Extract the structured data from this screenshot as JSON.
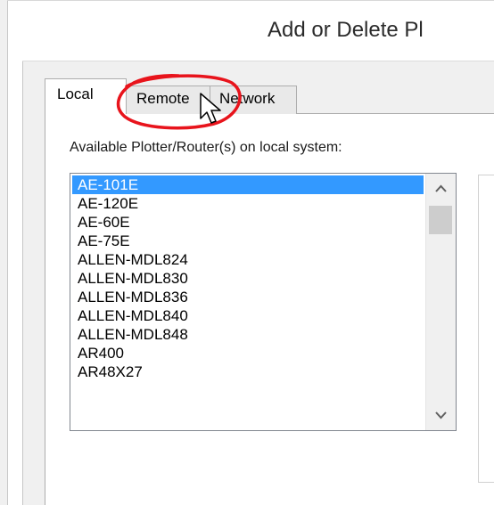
{
  "dialog": {
    "title": "Add or Delete Pl"
  },
  "tabs": [
    {
      "label": "Local",
      "selected": true
    },
    {
      "label": "Remote",
      "selected": false
    },
    {
      "label": "Network",
      "selected": false
    }
  ],
  "plotter_list": {
    "label": "Available Plotter/Router(s) on local system:",
    "items": [
      {
        "label": "AE-101E",
        "selected": true
      },
      {
        "label": "AE-120E",
        "selected": false
      },
      {
        "label": "AE-60E",
        "selected": false
      },
      {
        "label": "AE-75E",
        "selected": false
      },
      {
        "label": "ALLEN-MDL824",
        "selected": false
      },
      {
        "label": "ALLEN-MDL830",
        "selected": false
      },
      {
        "label": "ALLEN-MDL836",
        "selected": false
      },
      {
        "label": "ALLEN-MDL840",
        "selected": false
      },
      {
        "label": "ALLEN-MDL848",
        "selected": false
      },
      {
        "label": "AR400",
        "selected": false
      },
      {
        "label": "AR48X27",
        "selected": false
      }
    ]
  },
  "icons": {
    "scroll_up": "chevron-up-icon",
    "scroll_down": "chevron-down-icon",
    "cursor": "mouse-cursor-icon"
  },
  "colors": {
    "selection": "#3399ff",
    "annotation": "#e8141c",
    "panel_background": "#f0f0f0"
  }
}
